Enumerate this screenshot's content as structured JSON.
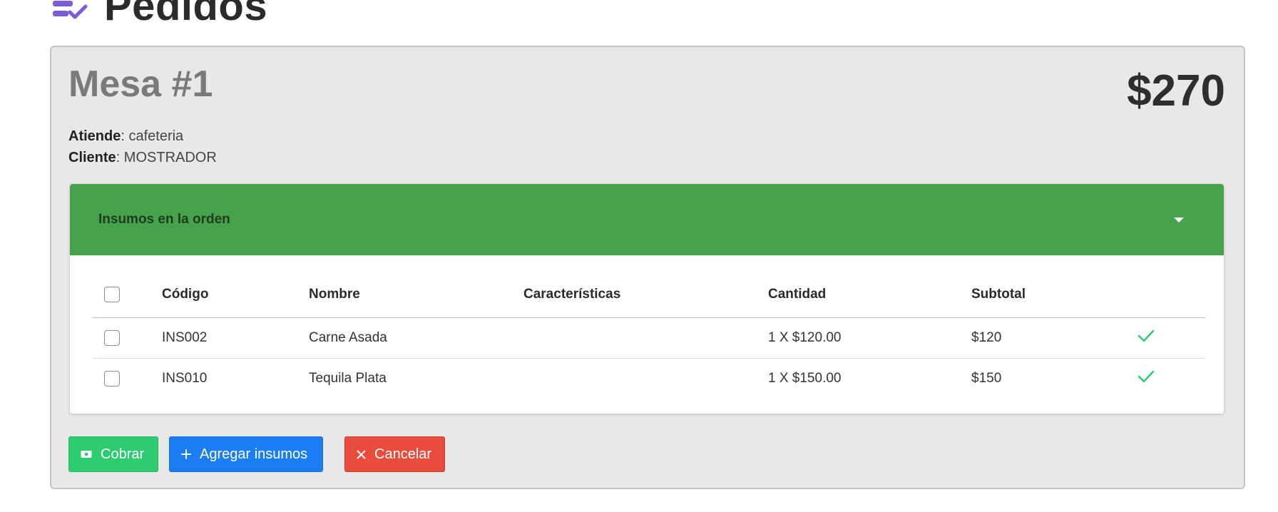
{
  "page": {
    "title": "Pedidos",
    "icon": "clipboard-check-icon"
  },
  "order": {
    "table_title": "Mesa #1",
    "total": "$270",
    "attend_label": "Atiende",
    "attend_value": ": cafeteria",
    "client_label": "Cliente",
    "client_value": ": MOSTRADOR"
  },
  "panel": {
    "title": "Insumos en la orden",
    "header_color": "#46a34b"
  },
  "table": {
    "headers": [
      "Código",
      "Nombre",
      "Características",
      "Cantidad",
      "Subtotal"
    ],
    "rows": [
      {
        "code": "INS002",
        "name": "Carne Asada",
        "features": "",
        "quantity": "1 X $120.00",
        "subtotal": "$120"
      },
      {
        "code": "INS010",
        "name": "Tequila Plata",
        "features": "",
        "quantity": "1 X $150.00",
        "subtotal": "$150"
      }
    ]
  },
  "actions": {
    "charge_label": "Cobrar",
    "add_label": "Agregar insumos",
    "cancel_label": "Cancelar"
  },
  "colors": {
    "charge": "#2ecc71",
    "add": "#1a7ef2",
    "cancel": "#e94b3c",
    "check": "#2ecc71",
    "title_icon": "#7b5cd6"
  }
}
